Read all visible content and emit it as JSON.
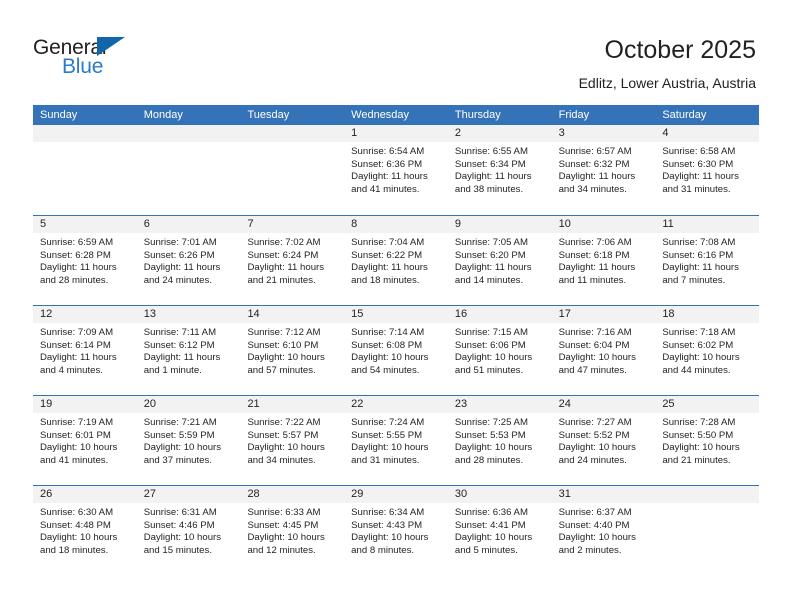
{
  "logo": {
    "word_top": "General",
    "word_bottom": "Blue",
    "triangle_color": "#1166ab",
    "blue_color": "#2b7cc4"
  },
  "header": {
    "title": "October 2025",
    "location": "Edlitz, Lower Austria, Austria"
  },
  "calendar": {
    "header_bg": "#3573b9",
    "daynum_bg": "#f2f2f2",
    "weekdays": [
      "Sunday",
      "Monday",
      "Tuesday",
      "Wednesday",
      "Thursday",
      "Friday",
      "Saturday"
    ],
    "weeks": [
      [
        {
          "day": "",
          "sunrise": "",
          "sunset": "",
          "daylight_1": "",
          "daylight_2": ""
        },
        {
          "day": "",
          "sunrise": "",
          "sunset": "",
          "daylight_1": "",
          "daylight_2": ""
        },
        {
          "day": "",
          "sunrise": "",
          "sunset": "",
          "daylight_1": "",
          "daylight_2": ""
        },
        {
          "day": "1",
          "sunrise": "Sunrise: 6:54 AM",
          "sunset": "Sunset: 6:36 PM",
          "daylight_1": "Daylight: 11 hours",
          "daylight_2": "and 41 minutes."
        },
        {
          "day": "2",
          "sunrise": "Sunrise: 6:55 AM",
          "sunset": "Sunset: 6:34 PM",
          "daylight_1": "Daylight: 11 hours",
          "daylight_2": "and 38 minutes."
        },
        {
          "day": "3",
          "sunrise": "Sunrise: 6:57 AM",
          "sunset": "Sunset: 6:32 PM",
          "daylight_1": "Daylight: 11 hours",
          "daylight_2": "and 34 minutes."
        },
        {
          "day": "4",
          "sunrise": "Sunrise: 6:58 AM",
          "sunset": "Sunset: 6:30 PM",
          "daylight_1": "Daylight: 11 hours",
          "daylight_2": "and 31 minutes."
        }
      ],
      [
        {
          "day": "5",
          "sunrise": "Sunrise: 6:59 AM",
          "sunset": "Sunset: 6:28 PM",
          "daylight_1": "Daylight: 11 hours",
          "daylight_2": "and 28 minutes."
        },
        {
          "day": "6",
          "sunrise": "Sunrise: 7:01 AM",
          "sunset": "Sunset: 6:26 PM",
          "daylight_1": "Daylight: 11 hours",
          "daylight_2": "and 24 minutes."
        },
        {
          "day": "7",
          "sunrise": "Sunrise: 7:02 AM",
          "sunset": "Sunset: 6:24 PM",
          "daylight_1": "Daylight: 11 hours",
          "daylight_2": "and 21 minutes."
        },
        {
          "day": "8",
          "sunrise": "Sunrise: 7:04 AM",
          "sunset": "Sunset: 6:22 PM",
          "daylight_1": "Daylight: 11 hours",
          "daylight_2": "and 18 minutes."
        },
        {
          "day": "9",
          "sunrise": "Sunrise: 7:05 AM",
          "sunset": "Sunset: 6:20 PM",
          "daylight_1": "Daylight: 11 hours",
          "daylight_2": "and 14 minutes."
        },
        {
          "day": "10",
          "sunrise": "Sunrise: 7:06 AM",
          "sunset": "Sunset: 6:18 PM",
          "daylight_1": "Daylight: 11 hours",
          "daylight_2": "and 11 minutes."
        },
        {
          "day": "11",
          "sunrise": "Sunrise: 7:08 AM",
          "sunset": "Sunset: 6:16 PM",
          "daylight_1": "Daylight: 11 hours",
          "daylight_2": "and 7 minutes."
        }
      ],
      [
        {
          "day": "12",
          "sunrise": "Sunrise: 7:09 AM",
          "sunset": "Sunset: 6:14 PM",
          "daylight_1": "Daylight: 11 hours",
          "daylight_2": "and 4 minutes."
        },
        {
          "day": "13",
          "sunrise": "Sunrise: 7:11 AM",
          "sunset": "Sunset: 6:12 PM",
          "daylight_1": "Daylight: 11 hours",
          "daylight_2": "and 1 minute."
        },
        {
          "day": "14",
          "sunrise": "Sunrise: 7:12 AM",
          "sunset": "Sunset: 6:10 PM",
          "daylight_1": "Daylight: 10 hours",
          "daylight_2": "and 57 minutes."
        },
        {
          "day": "15",
          "sunrise": "Sunrise: 7:14 AM",
          "sunset": "Sunset: 6:08 PM",
          "daylight_1": "Daylight: 10 hours",
          "daylight_2": "and 54 minutes."
        },
        {
          "day": "16",
          "sunrise": "Sunrise: 7:15 AM",
          "sunset": "Sunset: 6:06 PM",
          "daylight_1": "Daylight: 10 hours",
          "daylight_2": "and 51 minutes."
        },
        {
          "day": "17",
          "sunrise": "Sunrise: 7:16 AM",
          "sunset": "Sunset: 6:04 PM",
          "daylight_1": "Daylight: 10 hours",
          "daylight_2": "and 47 minutes."
        },
        {
          "day": "18",
          "sunrise": "Sunrise: 7:18 AM",
          "sunset": "Sunset: 6:02 PM",
          "daylight_1": "Daylight: 10 hours",
          "daylight_2": "and 44 minutes."
        }
      ],
      [
        {
          "day": "19",
          "sunrise": "Sunrise: 7:19 AM",
          "sunset": "Sunset: 6:01 PM",
          "daylight_1": "Daylight: 10 hours",
          "daylight_2": "and 41 minutes."
        },
        {
          "day": "20",
          "sunrise": "Sunrise: 7:21 AM",
          "sunset": "Sunset: 5:59 PM",
          "daylight_1": "Daylight: 10 hours",
          "daylight_2": "and 37 minutes."
        },
        {
          "day": "21",
          "sunrise": "Sunrise: 7:22 AM",
          "sunset": "Sunset: 5:57 PM",
          "daylight_1": "Daylight: 10 hours",
          "daylight_2": "and 34 minutes."
        },
        {
          "day": "22",
          "sunrise": "Sunrise: 7:24 AM",
          "sunset": "Sunset: 5:55 PM",
          "daylight_1": "Daylight: 10 hours",
          "daylight_2": "and 31 minutes."
        },
        {
          "day": "23",
          "sunrise": "Sunrise: 7:25 AM",
          "sunset": "Sunset: 5:53 PM",
          "daylight_1": "Daylight: 10 hours",
          "daylight_2": "and 28 minutes."
        },
        {
          "day": "24",
          "sunrise": "Sunrise: 7:27 AM",
          "sunset": "Sunset: 5:52 PM",
          "daylight_1": "Daylight: 10 hours",
          "daylight_2": "and 24 minutes."
        },
        {
          "day": "25",
          "sunrise": "Sunrise: 7:28 AM",
          "sunset": "Sunset: 5:50 PM",
          "daylight_1": "Daylight: 10 hours",
          "daylight_2": "and 21 minutes."
        }
      ],
      [
        {
          "day": "26",
          "sunrise": "Sunrise: 6:30 AM",
          "sunset": "Sunset: 4:48 PM",
          "daylight_1": "Daylight: 10 hours",
          "daylight_2": "and 18 minutes."
        },
        {
          "day": "27",
          "sunrise": "Sunrise: 6:31 AM",
          "sunset": "Sunset: 4:46 PM",
          "daylight_1": "Daylight: 10 hours",
          "daylight_2": "and 15 minutes."
        },
        {
          "day": "28",
          "sunrise": "Sunrise: 6:33 AM",
          "sunset": "Sunset: 4:45 PM",
          "daylight_1": "Daylight: 10 hours",
          "daylight_2": "and 12 minutes."
        },
        {
          "day": "29",
          "sunrise": "Sunrise: 6:34 AM",
          "sunset": "Sunset: 4:43 PM",
          "daylight_1": "Daylight: 10 hours",
          "daylight_2": "and 8 minutes."
        },
        {
          "day": "30",
          "sunrise": "Sunrise: 6:36 AM",
          "sunset": "Sunset: 4:41 PM",
          "daylight_1": "Daylight: 10 hours",
          "daylight_2": "and 5 minutes."
        },
        {
          "day": "31",
          "sunrise": "Sunrise: 6:37 AM",
          "sunset": "Sunset: 4:40 PM",
          "daylight_1": "Daylight: 10 hours",
          "daylight_2": "and 2 minutes."
        },
        {
          "day": "",
          "sunrise": "",
          "sunset": "",
          "daylight_1": "",
          "daylight_2": ""
        }
      ]
    ]
  }
}
